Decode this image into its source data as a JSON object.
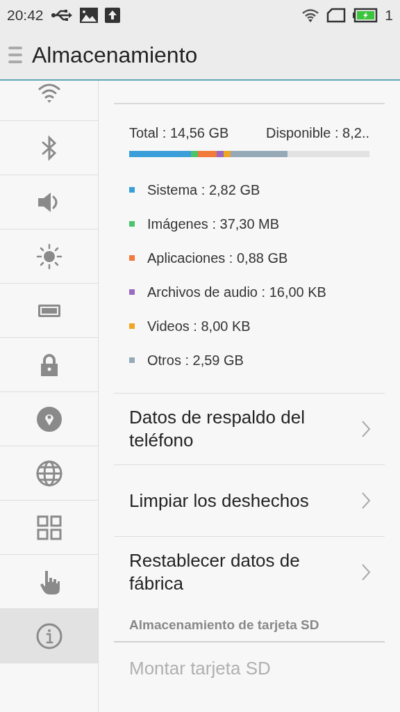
{
  "status_bar": {
    "time": "20:42",
    "battery_text": "1"
  },
  "header": {
    "title": "Almacenamiento"
  },
  "sidebar": {
    "items": [
      {
        "kind": "wifi",
        "selected": false
      },
      {
        "kind": "bluetooth",
        "selected": false
      },
      {
        "kind": "sound",
        "selected": false
      },
      {
        "kind": "brightness",
        "selected": false
      },
      {
        "kind": "battery",
        "selected": false
      },
      {
        "kind": "lock",
        "selected": false
      },
      {
        "kind": "location",
        "selected": false
      },
      {
        "kind": "globe",
        "selected": false
      },
      {
        "kind": "apps",
        "selected": false
      },
      {
        "kind": "gesture",
        "selected": false
      },
      {
        "kind": "info",
        "selected": true
      }
    ]
  },
  "storage": {
    "total": "Total : 14,56 GB",
    "available": "Disponible : 8,2..",
    "categories": [
      {
        "label": "Sistema : 2,82 GB",
        "color": "#3a9fd9"
      },
      {
        "label": "Imágenes : 37,30 MB",
        "color": "#4cc46e"
      },
      {
        "label": "Aplicaciones : 0,88 GB",
        "color": "#f27a3a"
      },
      {
        "label": "Archivos de audio : 16,00 KB",
        "color": "#9a6ac0"
      },
      {
        "label": "Videos : 8,00 KB",
        "color": "#eea623"
      },
      {
        "label": "Otros : 2,59 GB",
        "color": "#95a9b6"
      }
    ]
  },
  "actions": [
    {
      "label": "Datos de respaldo del teléfono"
    },
    {
      "label": "Limpiar los deshechos"
    },
    {
      "label": "Restablecer datos de fábrica"
    }
  ],
  "sd_section": {
    "title": "Almacenamiento de tarjeta SD",
    "items": [
      {
        "label": "Montar tarjeta SD",
        "disabled": true
      }
    ]
  }
}
